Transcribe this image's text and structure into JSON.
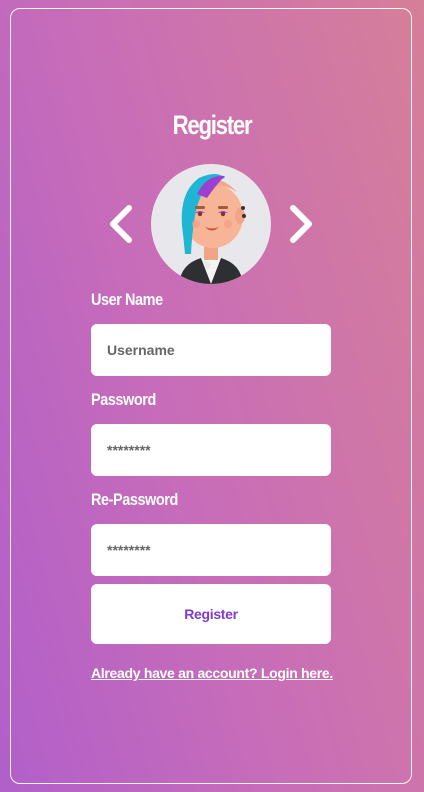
{
  "page": {
    "title": "Register"
  },
  "avatar": {
    "prev_icon": "chevron-left-icon",
    "next_icon": "chevron-right-icon",
    "image": "avatar-woman-blue-hair"
  },
  "form": {
    "username_label": "User Name",
    "username_placeholder": "Username",
    "password_label": "Password",
    "password_placeholder": "********",
    "repassword_label": "Re-Password",
    "repassword_placeholder": "********",
    "submit_label": "Register"
  },
  "footer": {
    "login_link": "Already have an account? Login here."
  },
  "colors": {
    "gradient_start": "#b15fca",
    "gradient_end": "#d67f98",
    "button_text": "#7d3bcf"
  }
}
